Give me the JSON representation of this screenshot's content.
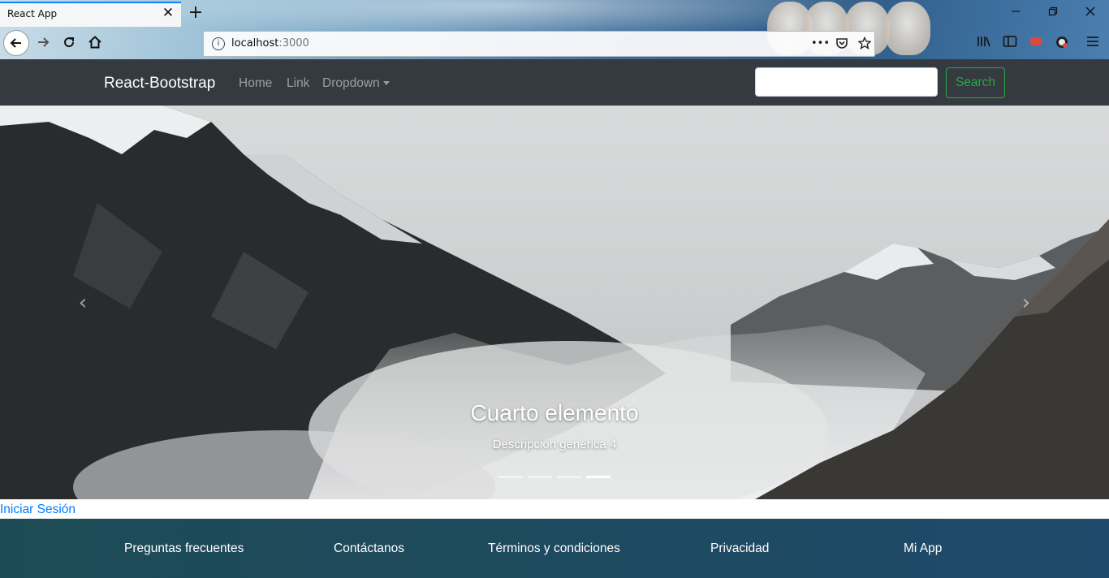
{
  "browser": {
    "tab_title": "React App",
    "tab_close": "✕",
    "new_tab": "+",
    "url_host": "localhost",
    "url_port": ":3000",
    "page_actions": "•••"
  },
  "navbar": {
    "brand": "React-Bootstrap",
    "links": [
      "Home",
      "Link",
      "Dropdown"
    ],
    "search_button": "Search",
    "search_value": ""
  },
  "carousel": {
    "caption_title": "Cuarto elemento",
    "caption_description": "Descripción genérica 4",
    "indicator_count": 4,
    "active_indicator": 4,
    "prev_icon": "‹",
    "next_icon": "›"
  },
  "login_link": "Iniciar Sesión",
  "footer": {
    "links": [
      "Preguntas frecuentes",
      "Contáctanos",
      "Términos y condiciones",
      "Privacidad",
      "Mi App"
    ]
  }
}
